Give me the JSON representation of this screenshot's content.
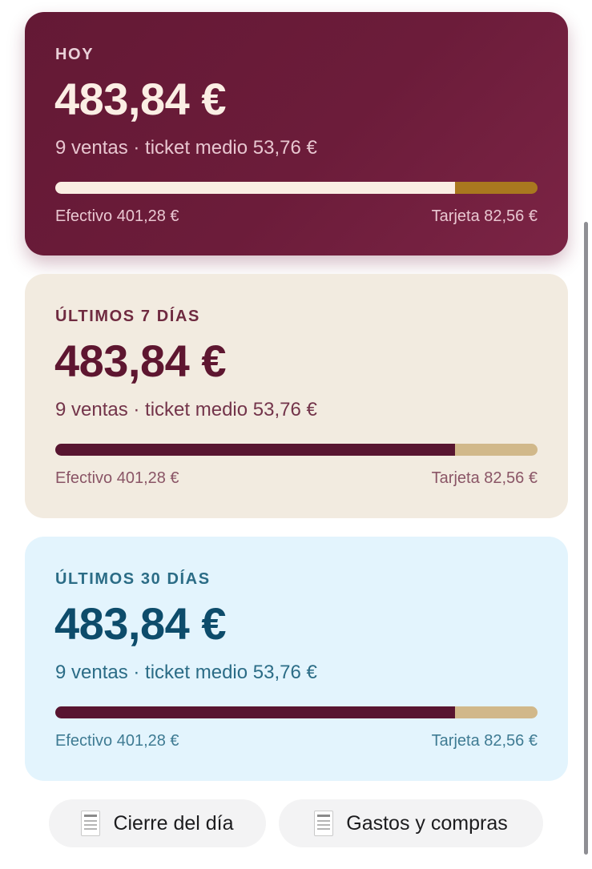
{
  "cards": [
    {
      "period": "HOY",
      "amount": "483,84 €",
      "summary": "9 ventas · ticket medio 53,76 €",
      "cash_label": "Efectivo 401,28 €",
      "card_label": "Tarjeta 82,56 €",
      "cash_fraction": 0.829
    },
    {
      "period": "ÚLTIMOS 7 DÍAS",
      "amount": "483,84 €",
      "summary": "9 ventas · ticket medio 53,76 €",
      "cash_label": "Efectivo 401,28 €",
      "card_label": "Tarjeta 82,56 €",
      "cash_fraction": 0.829
    },
    {
      "period": "ÚLTIMOS 30 DÍAS",
      "amount": "483,84 €",
      "summary": "9 ventas · ticket medio 53,76 €",
      "cash_label": "Efectivo 401,28 €",
      "card_label": "Tarjeta 82,56 €",
      "cash_fraction": 0.829
    }
  ],
  "actions": {
    "close_day_label": "Cierre del día",
    "expenses_label": "Gastos y compras",
    "icon": "receipt-icon"
  },
  "colors": {
    "today_bg": "#6c1c3a",
    "week_bg": "#f2ebe0",
    "month_bg": "#e3f4fd",
    "cash_bar": "#581530",
    "card_bar": "#d1b88a",
    "today_card_bar": "#a9781f"
  }
}
